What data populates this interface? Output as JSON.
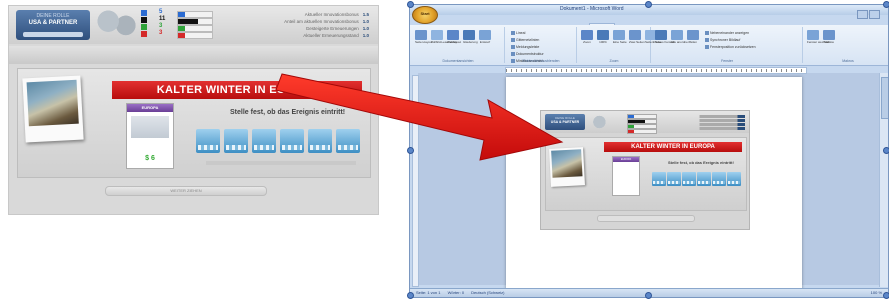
{
  "game": {
    "role_line1": "DEINE ROLLE",
    "role_line2": "USA & PARTNER",
    "counts": [
      {
        "icon": "factory-icon",
        "value": "5",
        "fill": 0.2,
        "color": "#2b6bd1"
      },
      {
        "icon": "factory-icon",
        "value": "11",
        "fill": 0.6,
        "color": "#111111"
      },
      {
        "icon": "vehicle-icon",
        "value": "3",
        "fill": 0.2,
        "color": "#2fa33a"
      },
      {
        "icon": "flag-icon",
        "value": "3",
        "fill": 0.2,
        "color": "#d42a2a"
      }
    ],
    "stats": [
      {
        "label": "Aktueller Innovationsbonus",
        "value": "1.5"
      },
      {
        "label": "Anteil am aktuellen Innovationsbonus",
        "value": "1.0"
      },
      {
        "label": "Gesteigerte Erneuerungen",
        "value": "1.0"
      },
      {
        "label": "Aktueller Erneuerungsstand",
        "value": "1.0"
      }
    ],
    "banner": "KALTER WINTER IN EUROPA",
    "event_card_head": "EUROPA",
    "event_card_value": "$ 6",
    "prompt": "Stelle fest, ob das Ereignis eintritt!",
    "tiles": [
      "",
      "",
      "",
      "",
      "",
      ""
    ],
    "bottom_button": "WEITER ZIEHEN"
  },
  "word": {
    "title": "Dokument1 - Microsoft Word",
    "office_button": "Start",
    "tabs": [
      "Einfügen",
      "Seitenlayout",
      "Verweise",
      "Sendungen",
      "Überprüfen",
      "Ansicht",
      "Add-Ins"
    ],
    "active_tab": "Ansicht",
    "ribbon_groups": [
      {
        "label": "Dokumentansichten",
        "buttons": [
          "Seiten-layout",
          "Vollbild-Lesemodus",
          "Weblayout",
          "Gliederung",
          "Entwurf"
        ]
      },
      {
        "label": "Einblenden/Ausblenden",
        "items": [
          "Lineal",
          "Gitternetzlinien",
          "Meldungsleiste",
          "Dokumentstruktur",
          "Miniaturansichten"
        ]
      },
      {
        "label": "Zoom",
        "buttons": [
          "Zoom",
          "100%",
          "Eine Seite",
          "Zwei Seiten",
          "Seitenbreite"
        ]
      },
      {
        "label": "Fenster",
        "buttons": [
          "Neues Fenster",
          "Alle anordnen",
          "Teilen"
        ],
        "items": [
          "Nebeneinander anzeigen",
          "Synchroner Bildlauf",
          "Fensterposition zurücksetzen"
        ]
      },
      {
        "label": "Makros",
        "buttons": [
          "Fenster wechseln",
          "Makros"
        ]
      }
    ],
    "status": [
      "Seite: 1 von 1",
      "Wörter: 0",
      "Deutsch (Schweiz)"
    ],
    "zoom": "100 %"
  },
  "mini": {
    "role": "USA & PARTNER",
    "role_top": "DEINE ROLLE",
    "banner": "KALTER WINTER IN EUROPA",
    "prompt": "Stelle fest, ob das Ereignis eintritt!",
    "event_head": "EUROPA",
    "bottom": "WEITER ZIEHEN"
  },
  "colors": {
    "banner_red": "#cf1c1c",
    "arrow_red": "#e21212",
    "word_blue": "#c6d8ef"
  }
}
